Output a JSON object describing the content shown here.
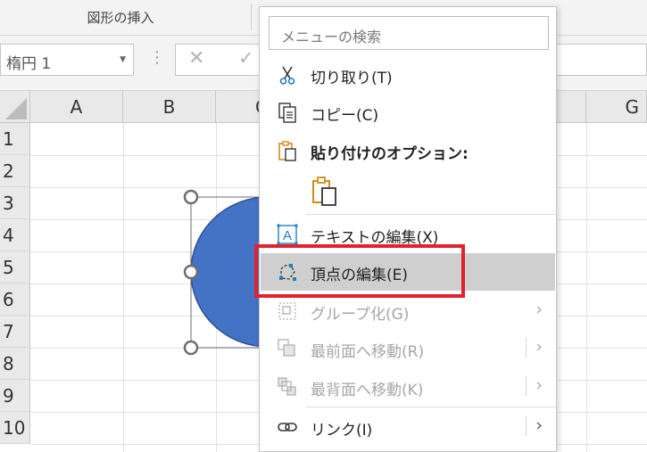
{
  "ribbon": {
    "group_label": "図形の挿入"
  },
  "formula_bar": {
    "name_box_value": "楕円 1",
    "cancel_symbol": "✕",
    "enter_symbol": "✓",
    "fx_dots": "⋮"
  },
  "grid": {
    "columns": [
      "A",
      "B",
      "C",
      "G"
    ],
    "rows": [
      "1",
      "2",
      "3",
      "4",
      "5",
      "6",
      "7",
      "8",
      "9",
      "10"
    ]
  },
  "shape": {
    "fill_color": "#4472c4",
    "name": "楕円 1"
  },
  "context_menu": {
    "search_placeholder": "メニューの検索",
    "items": [
      {
        "label": "切り取り(T)",
        "icon": "scissors-icon",
        "enabled": true
      },
      {
        "label": "コピー(C)",
        "icon": "copy-icon",
        "enabled": true
      },
      {
        "label": "貼り付けのオプション:",
        "icon": "paste-icon",
        "enabled": true
      },
      {
        "label": "テキストの編集(X)",
        "icon": "edit-text-icon",
        "enabled": true
      },
      {
        "label": "頂点の編集(E)",
        "icon": "edit-points-icon",
        "enabled": true,
        "highlighted": true
      },
      {
        "label": "グループ化(G)",
        "icon": "group-icon",
        "enabled": false,
        "submenu": true
      },
      {
        "label": "最前面へ移動(R)",
        "icon": "bring-to-front-icon",
        "enabled": false,
        "submenu": true
      },
      {
        "label": "最背面へ移動(K)",
        "icon": "send-to-back-icon",
        "enabled": false,
        "submenu": true
      },
      {
        "label": "リンク(I)",
        "icon": "link-icon",
        "enabled": true,
        "submenu": true
      }
    ],
    "submenu_arrow": "›"
  },
  "colors": {
    "highlight_annotation": "#e0222d",
    "accent_icon": "#1e7fc4",
    "paste_icon": "#d68a1c"
  }
}
